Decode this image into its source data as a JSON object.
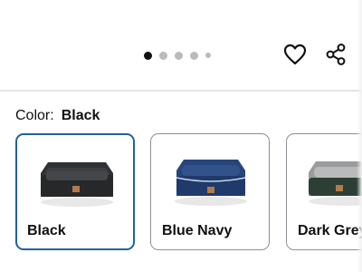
{
  "carousel": {
    "dots": [
      {
        "active": true,
        "size": "normal"
      },
      {
        "active": false,
        "size": "normal"
      },
      {
        "active": false,
        "size": "normal"
      },
      {
        "active": false,
        "size": "normal"
      },
      {
        "active": false,
        "size": "small"
      }
    ]
  },
  "actions": {
    "favorite_icon": "heart-icon",
    "share_icon": "share-icon"
  },
  "variation": {
    "label": "Color:",
    "selected_value": "Black",
    "options": [
      {
        "name": "Black",
        "selected": true,
        "bed_color": "#2f3133",
        "cushion_color": "#3d3f42"
      },
      {
        "name": "Blue Navy",
        "selected": false,
        "bed_color": "#27457b",
        "cushion_color": "#32528c"
      },
      {
        "name": "Dark Grey",
        "selected": false,
        "bed_color": "#9a9b9c",
        "cushion_color": "#b9babb"
      }
    ]
  },
  "colors": {
    "selected_border": "#2162a1",
    "default_border": "#8d9096",
    "dot_active": "#111111",
    "dot_inactive": "#bbbbbb"
  }
}
